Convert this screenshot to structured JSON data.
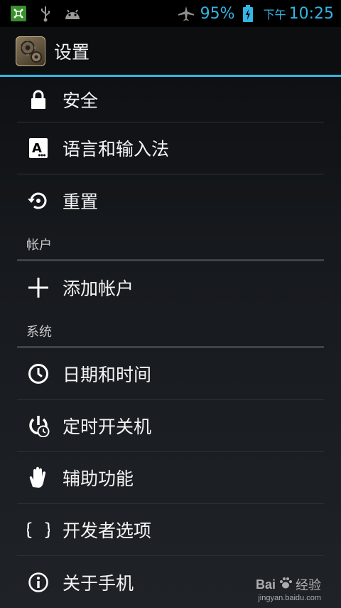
{
  "status_bar": {
    "icons_left": [
      "app-notification-icon",
      "usb-icon",
      "android-debug-icon"
    ],
    "airplane_icon": "airplane-icon",
    "battery_percent": "95%",
    "battery_icon": "battery-charging-icon",
    "time_prefix": "下午",
    "time": "10:25"
  },
  "action_bar": {
    "title": "设置",
    "accent_color": "#33b5e5"
  },
  "list": {
    "items_top": [
      {
        "icon": "lock-icon",
        "label": "安全"
      },
      {
        "icon": "language-keyboard-icon",
        "label": "语言和输入法"
      },
      {
        "icon": "reset-icon",
        "label": "重置"
      }
    ],
    "section_accounts": "帐户",
    "add_account": {
      "icon": "plus-icon",
      "label": "添加帐户"
    },
    "section_system": "系统",
    "items_system": [
      {
        "icon": "clock-icon",
        "label": "日期和时间"
      },
      {
        "icon": "power-schedule-icon",
        "label": "定时开关机"
      },
      {
        "icon": "hand-icon",
        "label": "辅助功能"
      },
      {
        "icon": "braces-icon",
        "label": "开发者选项"
      },
      {
        "icon": "info-icon",
        "label": "关于手机"
      }
    ]
  },
  "watermark": {
    "brand": "Bai",
    "brand2": "经验",
    "url": "jingyan.baidu.com"
  }
}
